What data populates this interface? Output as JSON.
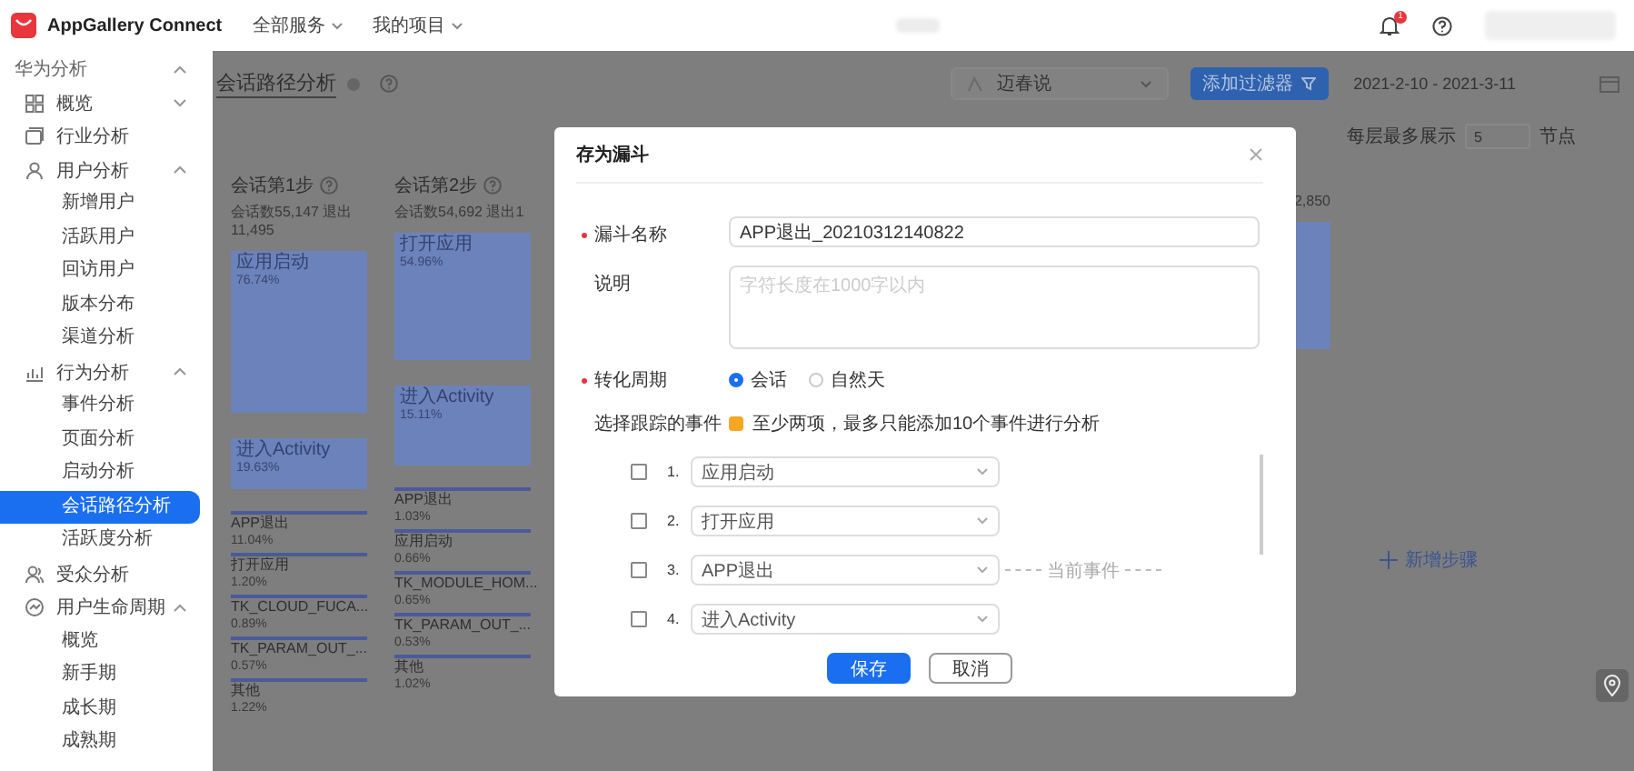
{
  "topbar": {
    "app_name": "AppGallery Connect",
    "menus": [
      {
        "label": "全部服务"
      },
      {
        "label": "我的项目"
      }
    ],
    "notification_badge": "1"
  },
  "sidebar": {
    "header": {
      "label": "华为分析",
      "expanded": true
    },
    "items": [
      {
        "label": "概览",
        "kind": "group",
        "expanded": false
      },
      {
        "label": "行业分析",
        "kind": "link"
      },
      {
        "label": "用户分析",
        "kind": "group",
        "expanded": true,
        "children": [
          {
            "label": "新增用户",
            "selected": false
          },
          {
            "label": "活跃用户",
            "selected": false
          },
          {
            "label": "回访用户",
            "selected": false
          },
          {
            "label": "版本分布",
            "selected": false
          },
          {
            "label": "渠道分析",
            "selected": false
          }
        ]
      },
      {
        "label": "行为分析",
        "kind": "group",
        "expanded": true,
        "children": [
          {
            "label": "事件分析",
            "selected": false
          },
          {
            "label": "页面分析",
            "selected": false
          },
          {
            "label": "启动分析",
            "selected": false
          },
          {
            "label": "会话路径分析",
            "selected": true
          },
          {
            "label": "活跃度分析",
            "selected": false
          }
        ]
      },
      {
        "label": "受众分析",
        "kind": "link"
      },
      {
        "label": "用户生命周期",
        "kind": "group",
        "expanded": true,
        "children": [
          {
            "label": "概览",
            "selected": false
          },
          {
            "label": "新手期",
            "selected": false
          },
          {
            "label": "成长期",
            "selected": false
          },
          {
            "label": "成熟期",
            "selected": false
          }
        ]
      }
    ]
  },
  "main": {
    "title": "会话路径分析",
    "select_value": "迈春说",
    "filter_button": "添加过滤器",
    "date_range": "2021-2-10 - 2021-3-11",
    "max_nodes_label": "每层最多展示",
    "max_nodes_value": "5",
    "max_nodes_unit": "节点",
    "add_step": "新增步骤",
    "steps": [
      {
        "title": "会话第1步",
        "caption": "会话数55,147  退出11,495",
        "nodes": [
          {
            "kind": "tall",
            "label": "应用启动",
            "pct": "76.74%"
          },
          {
            "kind": "short",
            "label": "进入Activity",
            "pct": "19.63%"
          },
          {
            "kind": "bar",
            "label": "APP退出",
            "pct": "11.04%"
          },
          {
            "kind": "bar",
            "label": "打开应用",
            "pct": "1.20%"
          },
          {
            "kind": "bar",
            "label": "TK_CLOUD_FUCA...",
            "pct": "0.89%"
          },
          {
            "kind": "bar",
            "label": "TK_PARAM_OUT_...",
            "pct": "0.57%"
          },
          {
            "kind": "bar",
            "label": "其他",
            "pct": "1.22%"
          }
        ]
      },
      {
        "title": "会话第2步",
        "caption": "会话数54,692  退出1",
        "nodes": [
          {
            "kind": "medium",
            "label": "打开应用",
            "pct": "54.96%"
          },
          {
            "kind": "low",
            "label": "进入Activity",
            "pct": "15.11%"
          },
          {
            "kind": "bar",
            "label": "APP退出",
            "pct": "1.03%"
          },
          {
            "kind": "bar",
            "label": "应用启动",
            "pct": "0.66%"
          },
          {
            "kind": "bar",
            "label": "TK_MODULE_HOM...",
            "pct": "0.65%"
          },
          {
            "kind": "bar",
            "label": "TK_PARAM_OUT_...",
            "pct": "0.53%"
          },
          {
            "kind": "bar",
            "label": "其他",
            "pct": "1.02%"
          }
        ]
      },
      {
        "caption": "2,850",
        "nodes": [
          {
            "kind": "medium"
          }
        ]
      }
    ]
  },
  "dialog": {
    "title": "存为漏斗",
    "name_label": "漏斗名称",
    "name_required": true,
    "name_value": "APP退出_20210312140822",
    "desc_label": "说明",
    "desc_placeholder": "字符长度在1000字以内",
    "period_label": "转化周期",
    "period_required": true,
    "period_options": [
      {
        "label": "会话",
        "selected": true
      },
      {
        "label": "自然天",
        "selected": false
      }
    ],
    "events_label": "选择跟踪的事件",
    "events_hint": "至少两项，最多只能添加10个事件进行分析",
    "events": [
      {
        "number": "1.",
        "value": "应用启动",
        "checked": false
      },
      {
        "number": "2.",
        "value": "打开应用",
        "checked": false
      },
      {
        "number": "3.",
        "value": "APP退出",
        "checked": false,
        "note": "当前事件"
      },
      {
        "number": "4.",
        "value": "进入Activity",
        "checked": false
      }
    ],
    "save_button": "保存",
    "cancel_button": "取消"
  }
}
